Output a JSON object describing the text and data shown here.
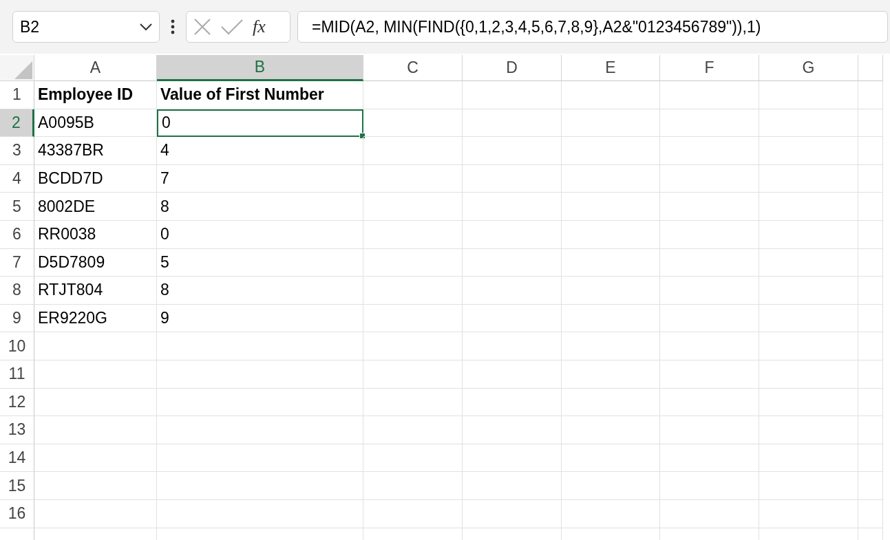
{
  "name_box": {
    "value": "B2"
  },
  "function_label": "fx",
  "formula": {
    "value": "=MID(A2, MIN(FIND({0,1,2,3,4,5,6,7,8,9},A2&\"0123456789\")),1)"
  },
  "columns": [
    {
      "label": "A",
      "selected": false
    },
    {
      "label": "B",
      "selected": true
    },
    {
      "label": "C",
      "selected": false
    },
    {
      "label": "D",
      "selected": false
    },
    {
      "label": "E",
      "selected": false
    },
    {
      "label": "F",
      "selected": false
    },
    {
      "label": "G",
      "selected": false
    }
  ],
  "rows": [
    {
      "label": "1",
      "selected": false,
      "kind": "header",
      "cells": [
        {
          "text": "Employee ID",
          "selected": false
        },
        {
          "text": "Value of First Number",
          "selected": false
        }
      ]
    },
    {
      "label": "2",
      "selected": true,
      "kind": "data",
      "cells": [
        {
          "text": "A0095B",
          "selected": false
        },
        {
          "text": "0",
          "selected": true
        }
      ]
    },
    {
      "label": "3",
      "selected": false,
      "kind": "data",
      "cells": [
        {
          "text": "43387BR",
          "selected": false
        },
        {
          "text": "4",
          "selected": false
        }
      ]
    },
    {
      "label": "4",
      "selected": false,
      "kind": "data",
      "cells": [
        {
          "text": "BCDD7D",
          "selected": false
        },
        {
          "text": "7",
          "selected": false
        }
      ]
    },
    {
      "label": "5",
      "selected": false,
      "kind": "data",
      "cells": [
        {
          "text": "8002DE",
          "selected": false
        },
        {
          "text": "8",
          "selected": false
        }
      ]
    },
    {
      "label": "6",
      "selected": false,
      "kind": "data",
      "cells": [
        {
          "text": "RR0038",
          "selected": false
        },
        {
          "text": "0",
          "selected": false
        }
      ]
    },
    {
      "label": "7",
      "selected": false,
      "kind": "data",
      "cells": [
        {
          "text": "D5D7809",
          "selected": false
        },
        {
          "text": "5",
          "selected": false
        }
      ]
    },
    {
      "label": "8",
      "selected": false,
      "kind": "data",
      "cells": [
        {
          "text": "RTJT804",
          "selected": false
        },
        {
          "text": "8",
          "selected": false
        }
      ]
    },
    {
      "label": "9",
      "selected": false,
      "kind": "data",
      "cells": [
        {
          "text": "ER9220G",
          "selected": false
        },
        {
          "text": "9",
          "selected": false
        }
      ]
    },
    {
      "label": "10",
      "selected": false,
      "kind": "empty"
    },
    {
      "label": "11",
      "selected": false,
      "kind": "empty"
    },
    {
      "label": "12",
      "selected": false,
      "kind": "empty"
    },
    {
      "label": "13",
      "selected": false,
      "kind": "empty"
    },
    {
      "label": "14",
      "selected": false,
      "kind": "empty"
    },
    {
      "label": "15",
      "selected": false,
      "kind": "empty"
    },
    {
      "label": "16",
      "selected": false,
      "kind": "empty"
    }
  ]
}
